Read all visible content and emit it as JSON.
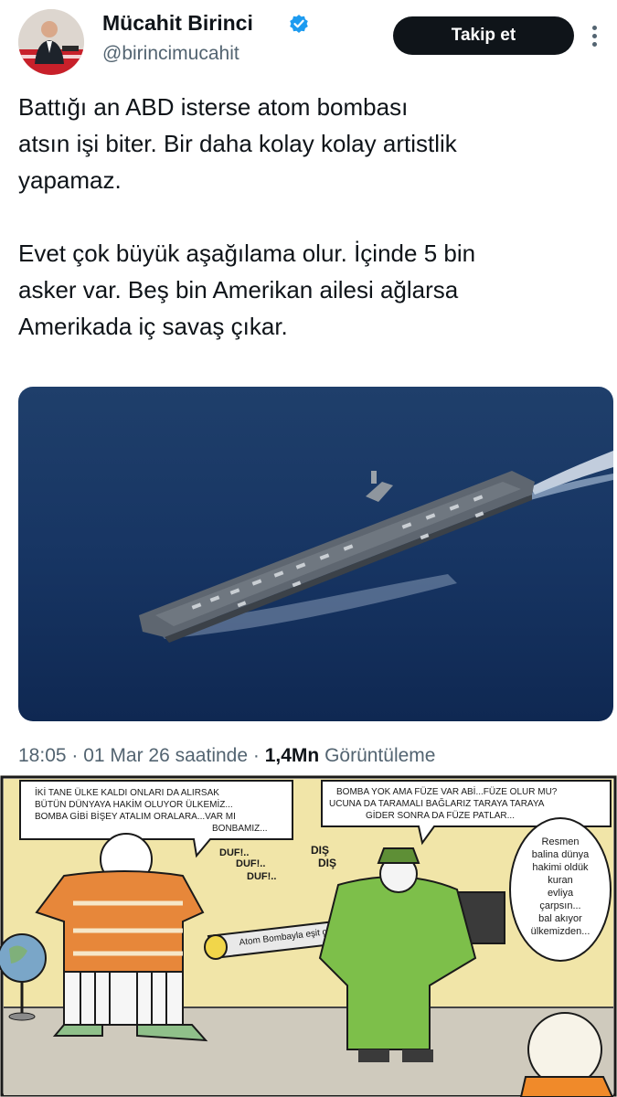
{
  "author": {
    "name": "Mücahit Birinci",
    "handle": "@birincimucahit",
    "follow_label": "Takip et"
  },
  "tweet": {
    "paragraphs": [
      "Battığı an ABD isterse atom bombası\natsın işi biter. Bir daha kolay kolay artistlik\nyapamaz.",
      "Evet çok büyük aşağılama olur. İçinde 5 bin\nasker var. Beş bin Amerikan ailesi ağlarsa\nAmerikada iç savaş çıkar."
    ]
  },
  "meta": {
    "time": "18:05",
    "date": "01 Mar 26 saatinde",
    "views": "1,4Mn",
    "views_label": "Görüntüleme"
  },
  "cartoon": {
    "bubble1": [
      "İKİ TANE ÜLKE KALDI ONLARI DA ALIRSAK",
      "BÜTÜN DÜNYAYA HAKİM OLUYOR ÜLKEMİZ...",
      "BOMBA GİBİ BİŞEY ATALIM ORALARA...VAR MI",
      "BONBAMIZ..."
    ],
    "bubble2": [
      "BOMBA YOK AMA FÜZE VAR ABİ...FÜZE OLUR MU?",
      "UCUNA DA TARAMALI BAĞLARIZ TARAYA TARAYA",
      "GİDER SONRA DA FÜZE PATLAR..."
    ],
    "bubble3": [
      "Resmen",
      "balina dünya",
      "hakimi oldük",
      "kuran",
      "evliya",
      "çarpsın...",
      "bal akıyor",
      "ülkemizden..."
    ],
    "sfx_duf": [
      "DUF!..",
      "DUF!..",
      "DUF!.."
    ],
    "sfx_dis": [
      "DIŞ",
      "DIŞ"
    ],
    "missile_text": "Atom Bombayla eşit güç..."
  },
  "colors": {
    "text": "#0f1419",
    "secondary": "#536471",
    "verified": "#1d9bf0",
    "follow_bg": "#0f1419"
  },
  "icons": {
    "verified": "verified-badge-icon",
    "more": "more-options-icon"
  }
}
